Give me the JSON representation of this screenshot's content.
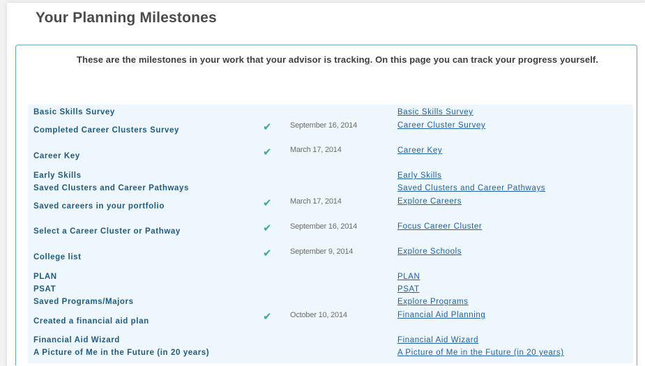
{
  "page": {
    "title": "Your Planning Milestones",
    "intro": "These are the milestones in your work that your advisor is tracking. On this page you can track your progress yourself."
  },
  "milestones": [
    {
      "label": "Basic Skills Survey",
      "completed": false,
      "date": "",
      "link": "Basic Skills Survey"
    },
    {
      "label": "Completed Career Clusters Survey",
      "completed": true,
      "date": "September 16, 2014",
      "link": "Career Cluster Survey"
    },
    {
      "label": "Career Key",
      "completed": true,
      "date": "March 17, 2014",
      "link": "Career Key"
    },
    {
      "label": "Early Skills",
      "completed": false,
      "date": "",
      "link": "Early Skills"
    },
    {
      "label": "Saved Clusters and Career Pathways",
      "completed": false,
      "date": "",
      "link": "Saved Clusters and Career Pathways"
    },
    {
      "label": "Saved careers in your portfolio",
      "completed": true,
      "date": "March 17, 2014",
      "link": "Explore Careers"
    },
    {
      "label": "Select a Career Cluster or Pathway",
      "completed": true,
      "date": "September 16, 2014",
      "link": "Focus Career Cluster"
    },
    {
      "label": "College list",
      "completed": true,
      "date": "September 9, 2014",
      "link": "Explore Schools"
    },
    {
      "label": "PLAN",
      "completed": false,
      "date": "",
      "link": "PLAN"
    },
    {
      "label": "PSAT",
      "completed": false,
      "date": "",
      "link": "PSAT"
    },
    {
      "label": "Saved Programs/Majors",
      "completed": false,
      "date": "",
      "link": "Explore Programs"
    },
    {
      "label": "Created a financial aid plan",
      "completed": true,
      "date": "October 10, 2014",
      "link": "Financial Aid Planning"
    },
    {
      "label": "Financial Aid Wizard",
      "completed": false,
      "date": "",
      "link": "Financial Aid Wizard"
    },
    {
      "label": "A Picture of Me in the Future (in 20 years)",
      "completed": false,
      "date": "",
      "link": "A Picture of Me in the Future (in 20 years)"
    }
  ],
  "icons": {
    "check": "checkmark-icon"
  },
  "colors": {
    "title": "#4a4a4a",
    "label": "#1f5a83",
    "link": "#1f5fa8",
    "check": "#3aa99a",
    "panel_border": "#6aa6c8",
    "table_bg": "#eef7fd"
  }
}
